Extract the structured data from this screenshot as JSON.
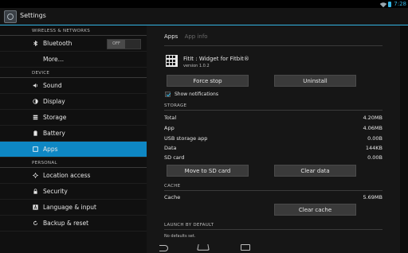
{
  "status": {
    "time": "7:28"
  },
  "actionbar": {
    "title": "Settings"
  },
  "sidebar": {
    "wireless_header": "WIRELESS & NETWORKS",
    "bluetooth_label": "Bluetooth",
    "bluetooth_toggle": "OFF",
    "more_label": "More…",
    "device_header": "DEVICE",
    "sound_label": "Sound",
    "display_label": "Display",
    "storage_label": "Storage",
    "battery_label": "Battery",
    "apps_label": "Apps",
    "personal_header": "PERSONAL",
    "location_label": "Location access",
    "security_label": "Security",
    "language_label": "Language & input",
    "backup_label": "Backup & reset"
  },
  "main": {
    "tab_apps": "Apps",
    "tab_appinfo": "App info",
    "app_name": "FitIt : Widget for Fitbit®",
    "app_version": "version 1.0.2",
    "force_stop": "Force stop",
    "uninstall": "Uninstall",
    "show_notifications": "Show notifications",
    "storage_header": "STORAGE",
    "storage_rows": [
      {
        "label": "Total",
        "value": "4.20MB"
      },
      {
        "label": "App",
        "value": "4.06MB"
      },
      {
        "label": "USB storage app",
        "value": "0.00B"
      },
      {
        "label": "Data",
        "value": "144KB"
      },
      {
        "label": "SD card",
        "value": "0.00B"
      }
    ],
    "move_to_sd": "Move to SD card",
    "clear_data": "Clear data",
    "cache_header": "CACHE",
    "cache_label": "Cache",
    "cache_value": "5.69MB",
    "clear_cache": "Clear cache",
    "launch_header": "LAUNCH BY DEFAULT",
    "no_defaults": "No defaults set."
  }
}
